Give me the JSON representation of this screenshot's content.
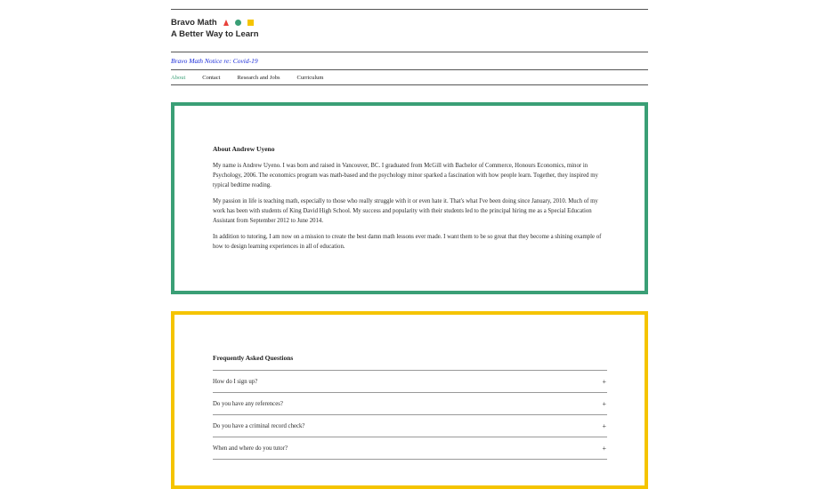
{
  "brand": {
    "name": "Bravo Math",
    "tagline": "A Better Way to Learn",
    "shapes": [
      "red-triangle",
      "green-circle",
      "yellow-square"
    ]
  },
  "notice": {
    "link_text": "Bravo Math Notice re: Covid-19"
  },
  "nav": {
    "items": [
      {
        "label": "About",
        "active": true
      },
      {
        "label": "Contact",
        "active": false
      },
      {
        "label": "Research and Jobs",
        "active": false
      },
      {
        "label": "Curriculum",
        "active": false
      }
    ]
  },
  "about": {
    "title": "About Andrew Uyeno",
    "paragraphs": [
      "My name is Andrew Uyeno. I was born and raised in Vancouver, BC. I graduated from McGill with Bachelor of Commerce, Honours Economics, minor in Psychology, 2006. The economics program was math-based and the psychology minor sparked a fascination with how people learn. Together, they inspired my typical bedtime reading.",
      "My passion in life is teaching math, especially to those who really struggle with it or even hate it. That's what I've been doing since January, 2010. Much of my work has been with students of King David High School. My success and popularity with their students led to the principal hiring me as a Special Education Assistant from September 2012 to June 2014.",
      "In addition to tutoring, I am now on a mission to create the best damn math lessons ever made. I want them to be so great that they become a shining example of how to design learning experiences in all of education."
    ]
  },
  "faq": {
    "title": "Frequently Asked Questions",
    "items": [
      {
        "question": "How do I sign up?",
        "toggle": "+"
      },
      {
        "question": "Do you have any references?",
        "toggle": "+"
      },
      {
        "question": "Do you have a criminal record check?",
        "toggle": "+"
      },
      {
        "question": "When and where do you tutor?",
        "toggle": "+"
      }
    ]
  },
  "colors": {
    "accent_green": "#3a9f76",
    "accent_yellow": "#f5c400",
    "accent_red": "#e8413a",
    "link_blue": "#1a2bd8"
  }
}
